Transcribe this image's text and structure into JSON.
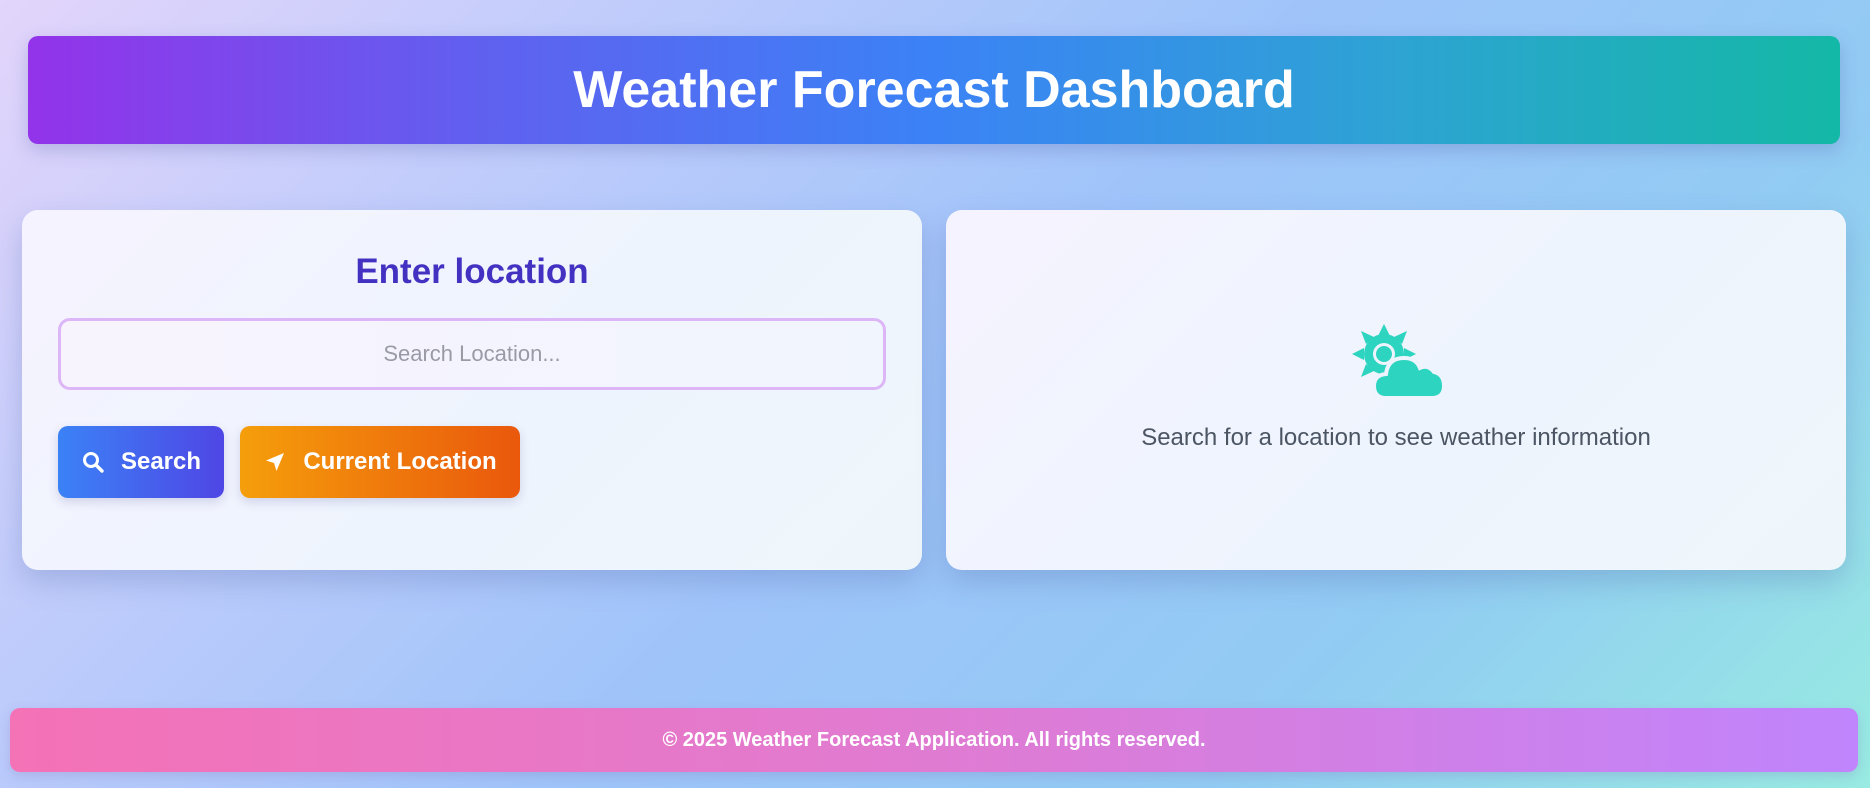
{
  "header": {
    "title": "Weather Forecast Dashboard"
  },
  "search_panel": {
    "title": "Enter location",
    "input_placeholder": "Search Location...",
    "input_value": "",
    "search_button_label": "Search",
    "search_button_icon": "search-icon",
    "location_button_label": "Current Location",
    "location_button_icon": "location-arrow-icon"
  },
  "weather_panel": {
    "icon": "sun-cloud-icon",
    "placeholder_text": "Search for a location to see weather information"
  },
  "footer": {
    "text": "© 2025 Weather Forecast Application. All rights reserved."
  },
  "colors": {
    "title_accent": "#4332c2",
    "weather_icon": "#2dd4bf",
    "search_button": "#4f46e5",
    "location_button": "#ea580c"
  }
}
